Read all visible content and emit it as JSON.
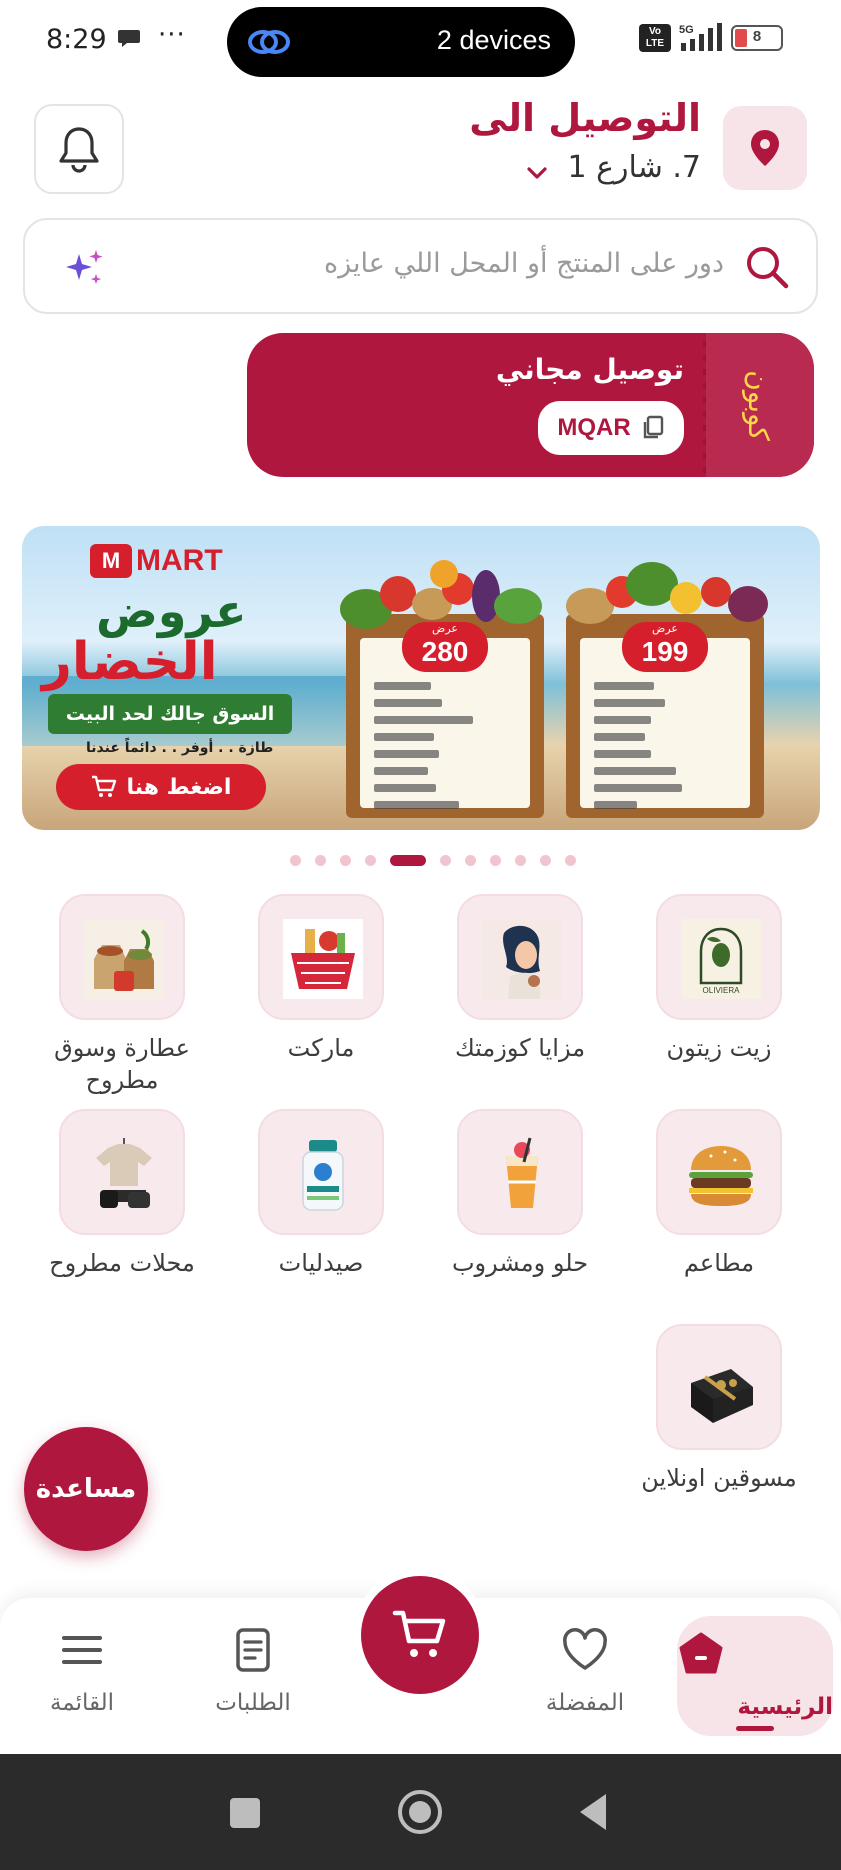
{
  "status_bar": {
    "time": "8:29",
    "more": "···",
    "pill_text": "2 devices",
    "volte": "Vo LTE",
    "network": "5G",
    "battery": "8"
  },
  "header": {
    "deliver_to": "التوصيل الى",
    "address": "7. شارع 1",
    "icons": [
      "bell-icon",
      "location-pin-icon",
      "chevron-down-icon"
    ]
  },
  "search": {
    "placeholder": "دور على المنتج أو المحل اللي عايزه"
  },
  "coupon": {
    "side_label": "كوبون",
    "title": "توصيل مجاني",
    "code": "MQAR"
  },
  "banner": {
    "brand": "MART",
    "headline_1": "عروض",
    "headline_2": "الخضار",
    "ribbon": "السوق جالك لحد البيت",
    "tagline": "طازة . . أوفر . . دائماً عندنا",
    "cta": "اضغط هنا",
    "crates": [
      {
        "offer": "عرض",
        "price": "280"
      },
      {
        "offer": "عرض",
        "price": "199"
      }
    ],
    "page_count": 11,
    "active_page": 5
  },
  "categories": [
    {
      "label": "زيت زيتون",
      "image": "olive-oil-logo"
    },
    {
      "label": "مزايا كوزمتك",
      "image": "cosmetics-woman"
    },
    {
      "label": "ماركت",
      "image": "grocery-basket"
    },
    {
      "label": "عطارة وسوق مطروح",
      "image": "spices-bags"
    },
    {
      "label": "مطاعم",
      "image": "burger"
    },
    {
      "label": "حلو ومشروب",
      "image": "drink-cup"
    },
    {
      "label": "صيدليات",
      "image": "medicine-bottle"
    },
    {
      "label": "محلات مطروح",
      "image": "clothes-shop"
    },
    {
      "label": "مسوقين اونلاين",
      "image": "gift-box"
    }
  ],
  "help_button": "مساعدة",
  "bottom_nav": {
    "home": "الرئيسية",
    "favorites": "المفضلة",
    "orders": "الطلبات",
    "menu": "القائمة"
  },
  "colors": {
    "brand": "#b0173f",
    "brand_light": "#f6e4e8",
    "coupon_accent": "#ffd84a"
  }
}
